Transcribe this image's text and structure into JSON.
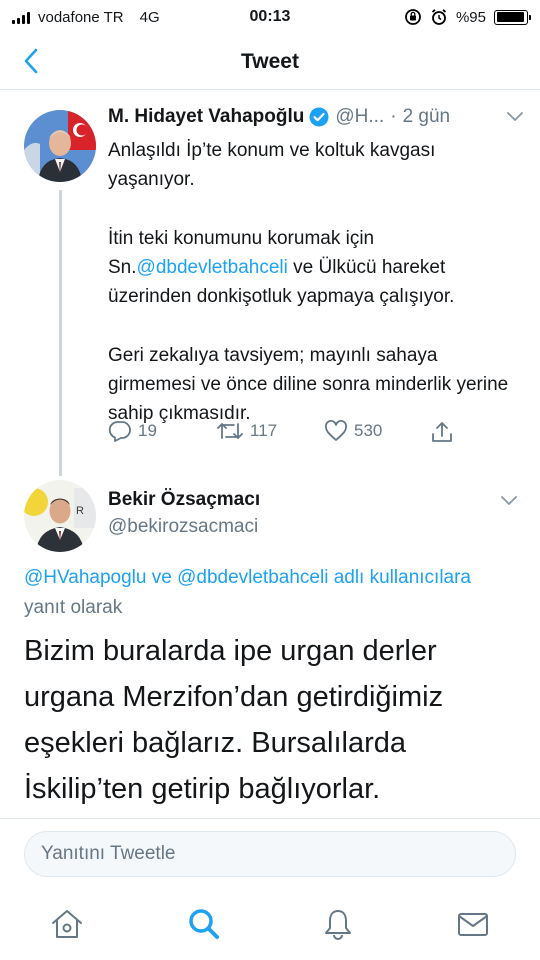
{
  "status_bar": {
    "carrier": "vodafone TR",
    "network": "4G",
    "time": "00:13",
    "battery": "%95",
    "battery_level": 0.95
  },
  "nav": {
    "title": "Tweet",
    "back_icon": "chevron-left-icon"
  },
  "tweet": {
    "author_name": "M. Hidayet Vahapoğlu",
    "handle": "@H...",
    "dot": "·",
    "time": "2 gün",
    "body": [
      {
        "segments": [
          "Anlaşıldı İp’te konum ve koltuk kavgası yaşanıyor."
        ]
      },
      {
        "segments": [
          "İtin teki konumunu korumak için Sn.",
          "@dbdevletbahceli",
          " ve Ülkücü hareket üzerinden donkişotluk yapmaya çalışıyor."
        ]
      },
      {
        "segments": [
          "Geri zekalıya tavsiyem; mayınlı sahaya girmemesi ve önce diline sonra minderlik yerine sahip çıkmasıdır."
        ]
      }
    ],
    "replies": "19",
    "retweets": "117",
    "likes": "530"
  },
  "reply": {
    "author_name": "Bekir Özsaçmacı",
    "handle": "@bekirozsacmaci",
    "reply_to_mention_1": "@HVahapoglu",
    "reply_to_conj": " ve ",
    "reply_to_mention_2": "@dbdevletbahceli adlı kullanıcılara",
    "reply_to_suffix": " yanıt olarak",
    "text": "Bizim buralarda ipe urgan derler urgana Merzifon’dan getirdiğimiz eşekleri bağlarız. Bursalılarda İskilip’ten getirip bağlıyorlar."
  },
  "composer": {
    "placeholder": "Yanıtını Tweetle"
  },
  "colors": {
    "accent": "#1da1f2",
    "secondary_text": "#657786"
  }
}
